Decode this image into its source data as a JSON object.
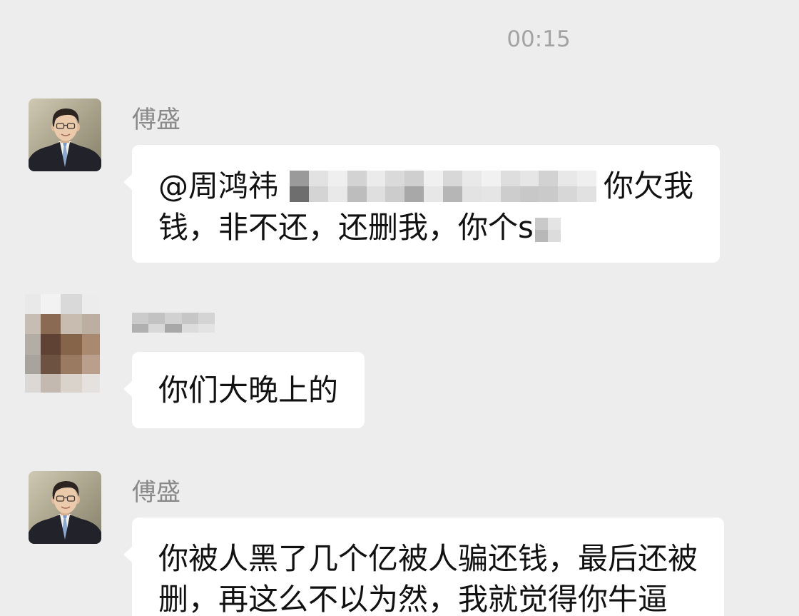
{
  "colors": {
    "background": "#ededed",
    "bubble": "#ffffff",
    "text": "#111111",
    "sender_name": "#8a8a8a",
    "timestamp": "#a3a3a3"
  },
  "timestamp": "00:15",
  "messages": [
    {
      "sender": "傅盛",
      "lines": [
        [
          "@周鸿祎",
          "你欠我"
        ],
        [
          "钱，非不还，还删我，你个s"
        ]
      ]
    },
    {
      "lines": [
        "你们大晚上的"
      ]
    },
    {
      "sender": "傅盛",
      "lines": [
        "你被人黑了几个亿被人骗还钱，最后还被",
        "删，再这么不以为然，我就觉得你牛逼"
      ]
    }
  ]
}
